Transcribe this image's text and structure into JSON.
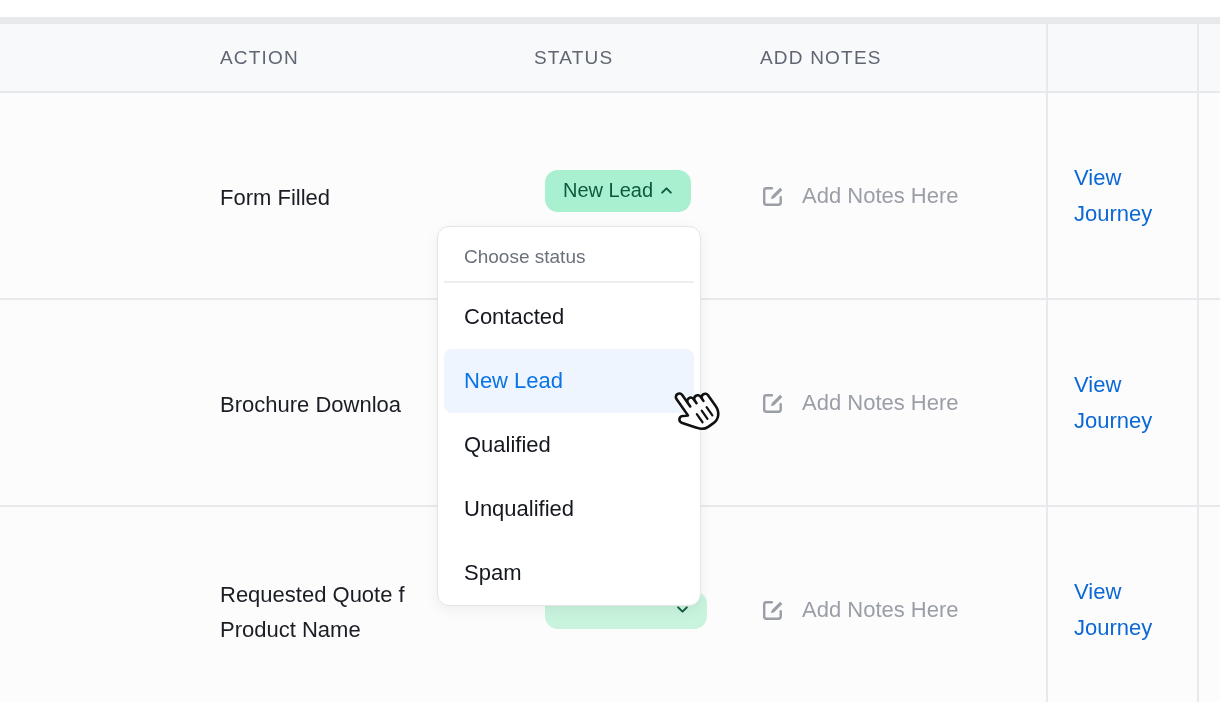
{
  "table": {
    "columns": [
      {
        "label": "ACTION"
      },
      {
        "label": "STATUS"
      },
      {
        "label": "ADD NOTES"
      }
    ],
    "rows": [
      {
        "action": "Form Filled",
        "status": {
          "label": "New Lead",
          "expanded": true
        },
        "notes": "Add Notes Here",
        "link": "View Journey"
      },
      {
        "action": "Brochure Downloa",
        "notes": "Add Notes Here",
        "link": "View Journey"
      },
      {
        "action": "Requested Quote f\nProduct Name",
        "status": {
          "expanded": false
        },
        "notes": "Add Notes Here",
        "link": "View Journey"
      }
    ]
  },
  "status_menu": {
    "heading": "Choose status",
    "options": [
      {
        "label": "Contacted",
        "selected": false
      },
      {
        "label": "New Lead",
        "selected": true
      },
      {
        "label": "Qualified",
        "selected": false
      },
      {
        "label": "Unqualified",
        "selected": false
      },
      {
        "label": "Spam",
        "selected": false
      }
    ]
  }
}
